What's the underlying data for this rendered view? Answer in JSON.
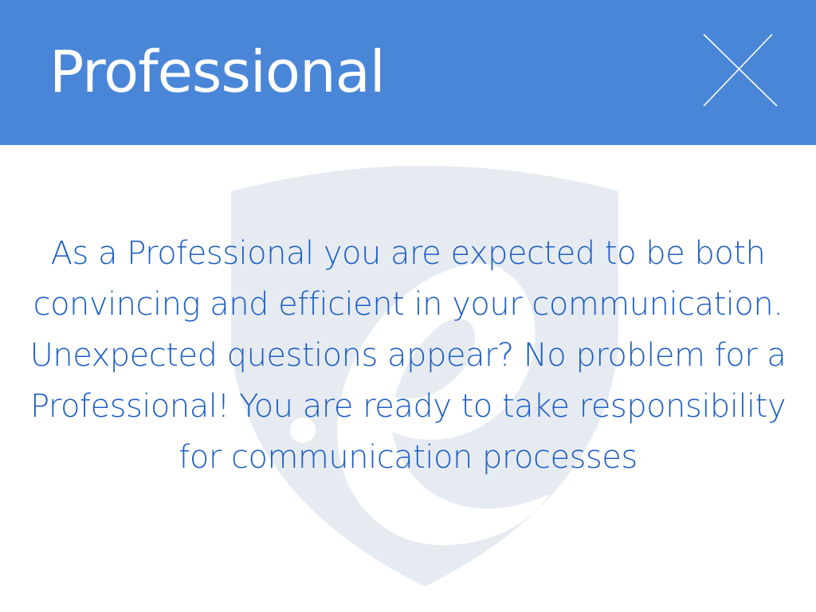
{
  "header": {
    "title": "Professional",
    "close_icon": "close-icon"
  },
  "watermark": {
    "icon": "shield-logo-icon"
  },
  "content": {
    "description": "As a Professional you are expected to be both convincing and efficient in your communication. Unexpected questions appear? No problem for a Professional! You are ready to take responsibility for communication processes"
  },
  "colors": {
    "header_background": "#4a86d8",
    "title_text": "#ffffff",
    "body_text": "#1f5fc4",
    "watermark": "#e6ebf2",
    "background": "#ffffff"
  }
}
